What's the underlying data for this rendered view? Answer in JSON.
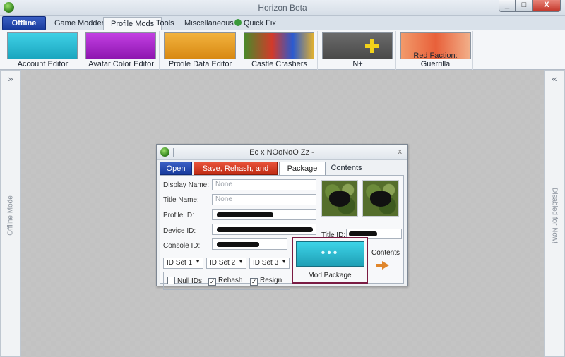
{
  "window": {
    "title": "Horizon Beta",
    "min": "_",
    "max": "□",
    "close": "X"
  },
  "tabs": [
    {
      "label": "Offline"
    },
    {
      "label": "Game Modders"
    },
    {
      "label": "Profile Mods"
    },
    {
      "label": "Tools"
    },
    {
      "label": "Miscellaneous"
    },
    {
      "label": "Quick Fix"
    }
  ],
  "ribbon": [
    {
      "label": "Account Editor",
      "color": "#1fb0c9"
    },
    {
      "label": "Avatar Color Editor",
      "color": "#a320c4"
    },
    {
      "label": "Profile Data Editor",
      "color": "#e89b1e"
    },
    {
      "label": "Castle Crashers",
      "color": "#4a7a2a"
    },
    {
      "label": "N+",
      "color": "#5e5e5e"
    },
    {
      "label": "Red Faction: Guerrilla",
      "color": "#e8703a"
    }
  ],
  "sidebars": {
    "left_text": "Offline Mode",
    "right_text": "Disabled for Now!",
    "left_arrow": "»",
    "right_arrow": "«"
  },
  "dialog": {
    "title": "Ec x NOoNoO Zz -",
    "close": "x",
    "tabs": {
      "open": "Open",
      "save": "Save, Rehash, and Resign",
      "package_info": "Package Info",
      "contents": "Contents"
    },
    "fields": {
      "display_name": {
        "label": "Display Name:",
        "placeholder": "None"
      },
      "title_name": {
        "label": "Title Name:",
        "placeholder": "None"
      },
      "profile_id": {
        "label": "Profile ID:"
      },
      "device_id": {
        "label": "Device ID:"
      },
      "console_id": {
        "label": "Console ID:"
      },
      "title_id": {
        "label": "Title ID:"
      }
    },
    "id_sets": [
      "ID Set 1",
      "ID Set 2",
      "ID Set 3"
    ],
    "checkboxes": [
      {
        "label": "Null IDs",
        "checked": false
      },
      {
        "label": "Rehash",
        "checked": true
      },
      {
        "label": "Resign",
        "checked": true
      }
    ],
    "mod_button": {
      "dots": "•••",
      "label": "Mod Package"
    },
    "contents_button": {
      "label": "Contents"
    }
  }
}
